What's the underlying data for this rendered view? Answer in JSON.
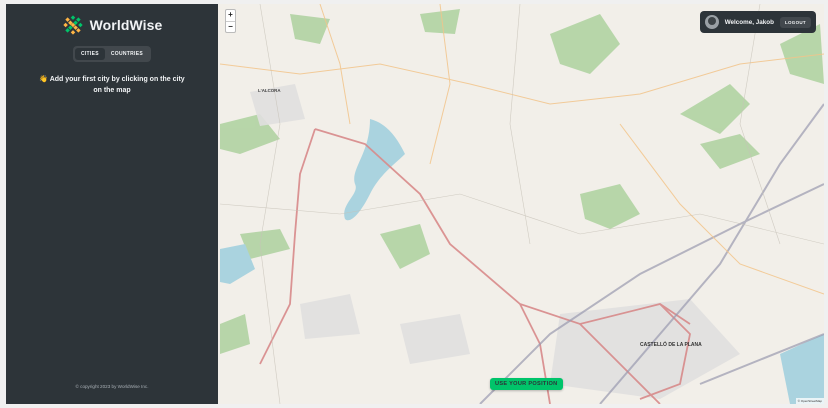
{
  "sidebar": {
    "logo_text": "WorldWise",
    "tabs": [
      {
        "label": "CITIES",
        "active": true
      },
      {
        "label": "COUNTRIES",
        "active": false
      }
    ],
    "message": "👋 Add your first city by clicking on the city on the map",
    "copyright": "© copyright 2023 by WorldWise Inc."
  },
  "map": {
    "zoom_in": "+",
    "zoom_out": "−",
    "user": {
      "welcome": "Welcome, Jakob",
      "logout": "LOGOUT"
    },
    "use_position": "USE YOUR POSITION",
    "city_label": "CASTELLÓ DE LA PLANA",
    "town_label": "L'ALCORA"
  },
  "colors": {
    "sidebar_bg": "#2d3439",
    "tab_bg": "#42484d",
    "accent_green": "#00c46a",
    "map_bg": "#f2efe9",
    "water": "#aad3df",
    "forest": "#add19e"
  }
}
